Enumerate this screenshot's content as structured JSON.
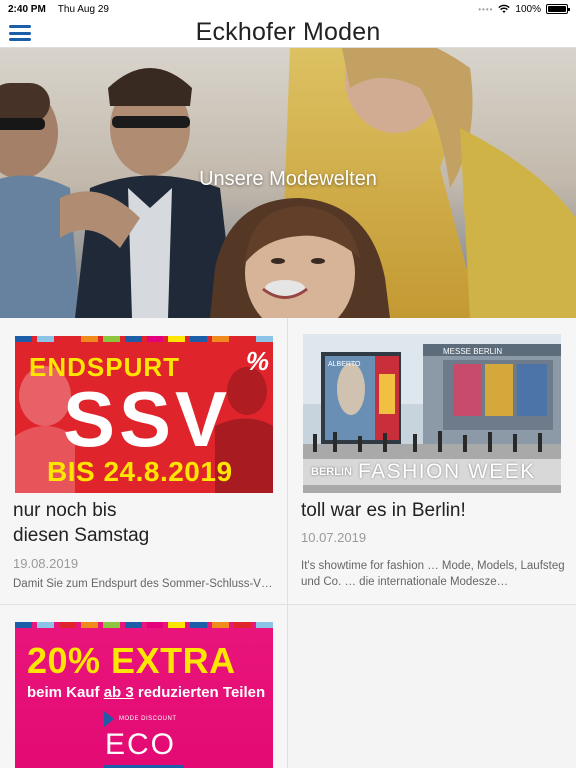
{
  "status_bar": {
    "time": "2:40 PM",
    "date": "Thu Aug 29",
    "battery": "100%",
    "battery_level": 1.0
  },
  "nav": {
    "title": "Eckhofer Moden"
  },
  "hero": {
    "title": "Unsere Modewelten"
  },
  "cards": [
    {
      "title_line1": "nur noch bis",
      "title_line2": "diesen Samstag",
      "date": "19.08.2019",
      "excerpt": "Damit Sie zum Endspurt des Sommer-Schluss-V…",
      "image": {
        "line1": "ENDSPURT",
        "line2": "SSV",
        "line3": "BIS 24.8.2019",
        "symbol": "%"
      }
    },
    {
      "title": "toll war es in Berlin!",
      "date": "10.07.2019",
      "excerpt": "It's showtime for fashion … Mode, Models, Laufsteg und Co. … die internationale Modesze…",
      "image": {
        "label_small": "BERLIN",
        "label_big": "FASHION WEEK",
        "sign": "MESSE BERLIN",
        "poster": "ALBERTO"
      }
    },
    {
      "image": {
        "line1": "20% EXTRA",
        "line2_pre": "beim Kauf ",
        "line2_u": "ab 3",
        "line2_post": " reduzierten Teilen",
        "tag": "MODE DISCOUNT",
        "brand": "ECO"
      }
    }
  ],
  "colors": {
    "accent": "#1c5ea8",
    "ssv_red": "#e0242b",
    "ssv_yellow": "#ffe600",
    "extra_pink": "#e30a73",
    "stripes": [
      "#1c5ea8",
      "#8cc4e8",
      "#e0242b",
      "#f08a1c",
      "#8cc63e",
      "#1c5ea8",
      "#e5007e",
      "#ffe600",
      "#1c5ea8",
      "#f08a1c",
      "#e0242b",
      "#8cc4e8"
    ]
  },
  "icons": {
    "menu": "hamburger-icon",
    "wifi": "wifi-icon",
    "battery": "battery-icon"
  }
}
